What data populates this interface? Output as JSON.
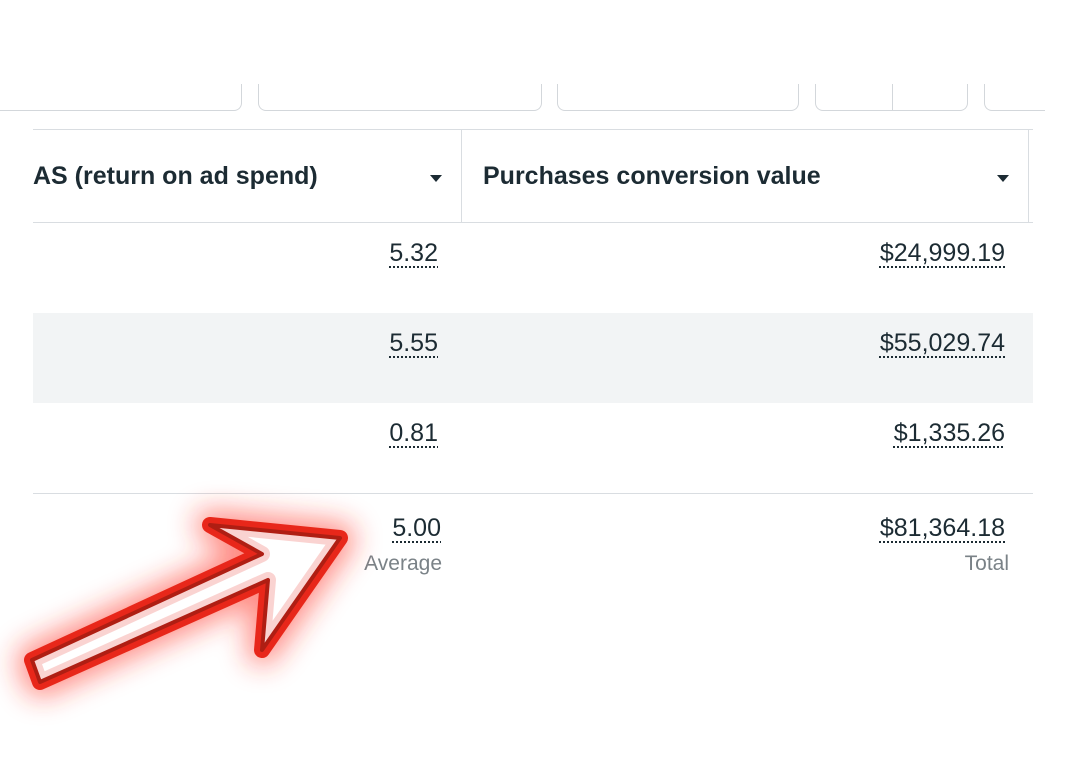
{
  "columns": [
    {
      "label": "AS (return on ad spend)",
      "sort_icon": "caret-down-icon"
    },
    {
      "label": "Purchases conversion value",
      "sort_icon": "caret-down-icon"
    }
  ],
  "rows": [
    {
      "roas": "5.32",
      "value": "$24,999.19"
    },
    {
      "roas": "5.55",
      "value": "$55,029.74"
    },
    {
      "roas": "0.81",
      "value": "$1,335.26"
    }
  ],
  "summary": {
    "roas": "5.00",
    "roas_label": "Average",
    "value": "$81,364.18",
    "value_label": "Total"
  },
  "annotation": {
    "icon": "red-arrow-icon",
    "color": "#e8271a"
  }
}
